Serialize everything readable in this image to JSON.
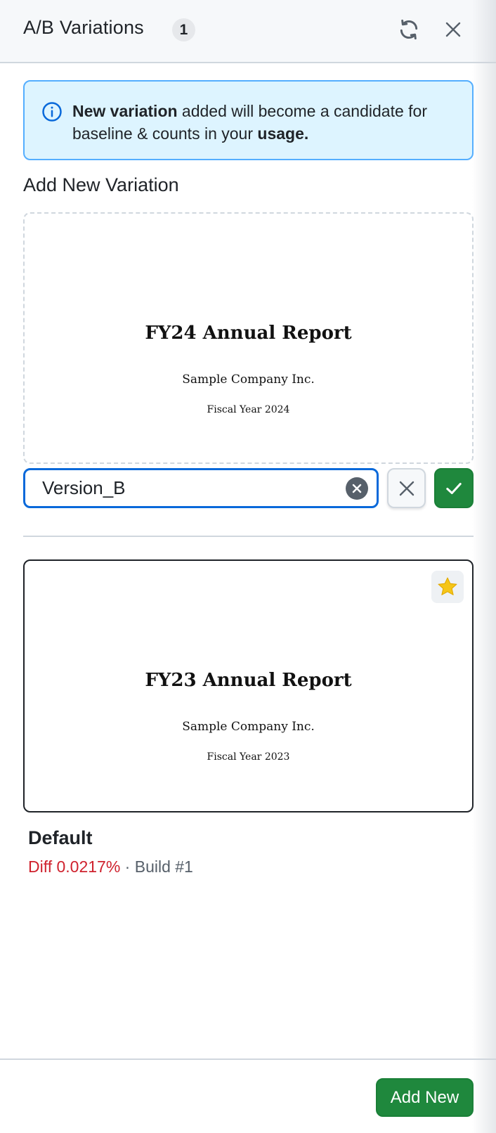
{
  "header": {
    "title": "A/B Variations",
    "count": "1"
  },
  "banner": {
    "bold_lead": "New variation",
    "text_mid": " added will become a candidate for baseline & counts in your ",
    "bold_tail": "usage."
  },
  "add_section": {
    "title": "Add New Variation",
    "preview": {
      "doc_title": "FY24 Annual Report",
      "doc_company": "Sample Company Inc.",
      "doc_year": "Fiscal Year 2024"
    },
    "name_input_value": "Version_B"
  },
  "variations": [
    {
      "name": "Default",
      "diff": "Diff 0.0217%",
      "separator": " · ",
      "build": "Build #1",
      "preview": {
        "doc_title": "FY23 Annual Report",
        "doc_company": "Sample Company Inc.",
        "doc_year": "Fiscal Year 2023"
      }
    }
  ],
  "footer": {
    "add_new_label": "Add New"
  },
  "colors": {
    "primary_green": "#1f883d",
    "focus_blue": "#0969da",
    "info_bg": "#ddf4ff",
    "diff_red": "#cf222e",
    "star_yellow": "#f5c518"
  },
  "icons": {
    "refresh": "refresh-icon",
    "close": "close-icon",
    "info": "info-icon",
    "clear": "clear-circle-icon",
    "cancel": "x-icon",
    "confirm": "check-icon",
    "baseline": "star-icon"
  }
}
